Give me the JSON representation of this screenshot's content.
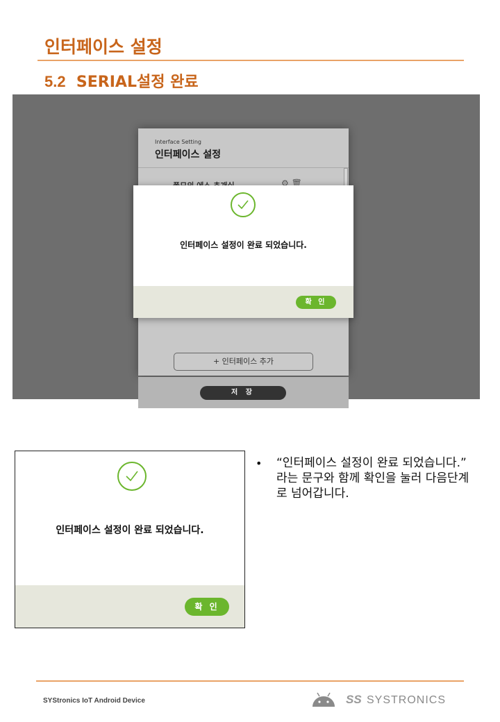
{
  "header": {
    "title": "인터페이스 설정",
    "section_number": "5.2",
    "section_title": "SERIAL설정 완료"
  },
  "screen": {
    "app_header_en": "Interface Setting",
    "app_header_ko": "인터페이스 설정",
    "row_label": "폴모의 에스 추개실",
    "add_interface_button": "+ 인터페이스 추가",
    "save_button": "저 장",
    "dialog": {
      "message": "인터페이스 설정이 완료 되었습니다.",
      "ok_button": "확 인"
    }
  },
  "zoom_dialog": {
    "message": "인터페이스 설정이 완료 되었습니다.",
    "ok_button": "확 인"
  },
  "description": {
    "bullet": "•",
    "text": "“인터페이스 설정이 완료 되었습니다.” 라는 문구와 함께 확인을 눌러 다음단계로 넘어갑니다."
  },
  "footer": {
    "left_text": "SYStronics IoT Android Device",
    "brand_mark": "SS",
    "brand_name": "SYSTRONICS"
  },
  "colors": {
    "accent_orange": "#c8651b",
    "rule_orange": "#e9a266",
    "confirm_green": "#6bb62d",
    "dialog_footer": "#e6e7dc"
  }
}
